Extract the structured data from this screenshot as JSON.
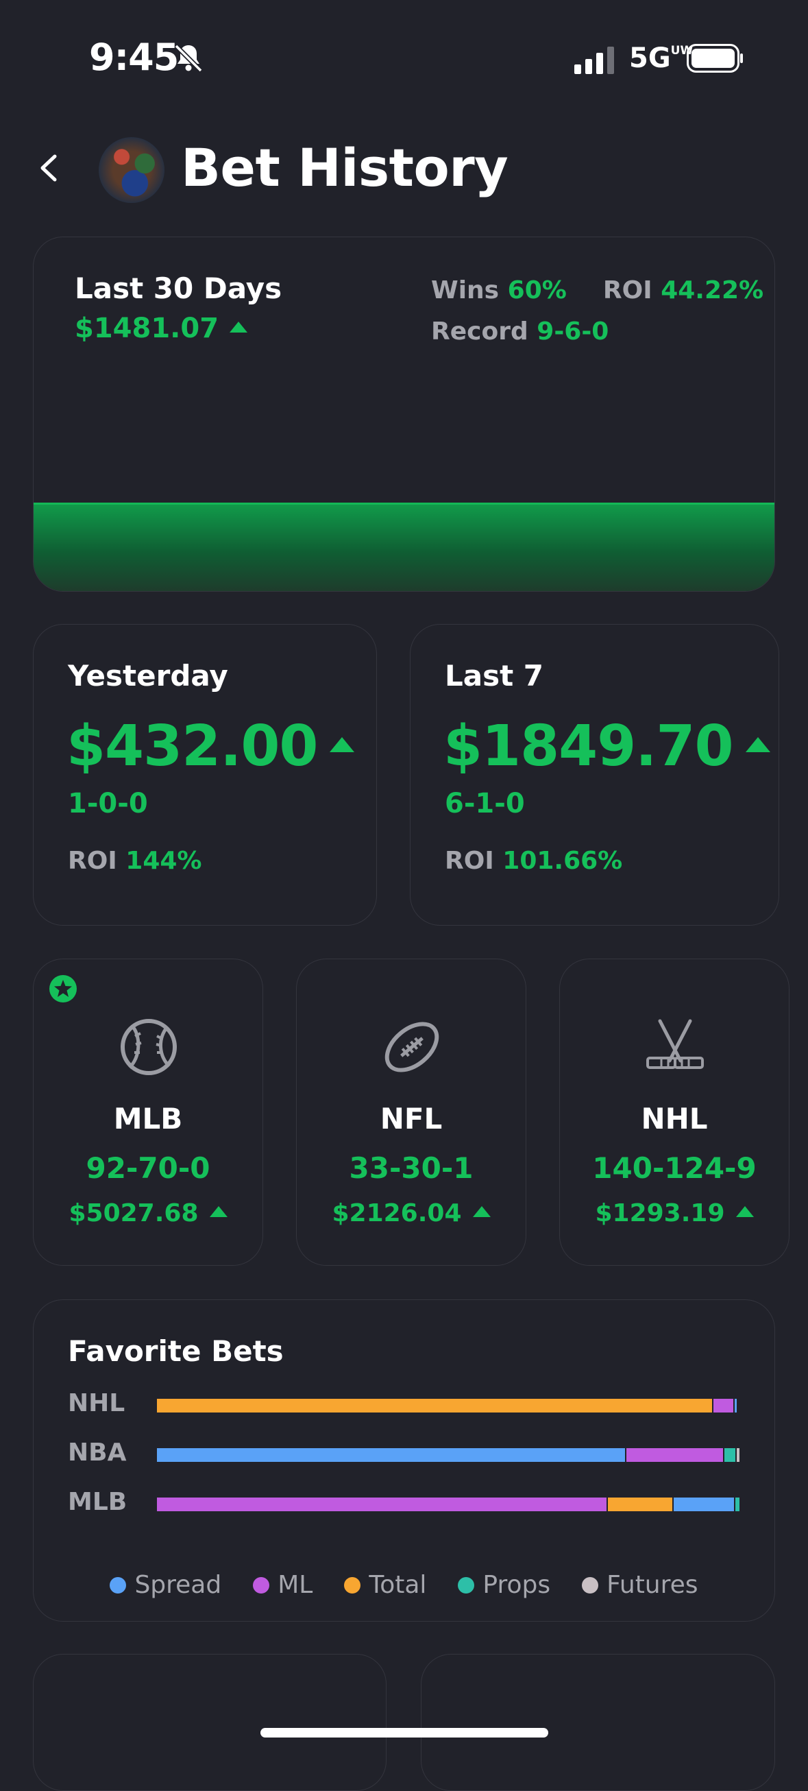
{
  "status_bar": {
    "time": "9:45",
    "network": "5G",
    "network_sup": "UW"
  },
  "header": {
    "title": "Bet History"
  },
  "last30": {
    "label": "Last 30 Days",
    "amount": "$1481.07",
    "wins_label": "Wins",
    "wins_value": "60%",
    "roi_label": "ROI",
    "roi_value": "44.22%",
    "record_label": "Record",
    "record_value": "9-6-0"
  },
  "periods": [
    {
      "label": "Yesterday",
      "amount": "$432.00",
      "record": "1-0-0",
      "roi_label": "ROI",
      "roi_value": "144%"
    },
    {
      "label": "Last 7",
      "amount": "$1849.70",
      "record": "6-1-0",
      "roi_label": "ROI",
      "roi_value": "101.66%"
    }
  ],
  "sports": [
    {
      "name": "MLB",
      "record": "92-70-0",
      "amount": "$5027.68",
      "icon": "baseball-icon",
      "favorite": true
    },
    {
      "name": "NFL",
      "record": "33-30-1",
      "amount": "$2126.04",
      "icon": "football-icon"
    },
    {
      "name": "NHL",
      "record": "140-124-9",
      "amount": "$1293.19",
      "icon": "hockey-sticks-icon"
    }
  ],
  "favorite_bets": {
    "title": "Favorite Bets",
    "rows": [
      {
        "label": "NHL",
        "segments": [
          {
            "type": "Total",
            "pct": 95.3
          },
          {
            "type": "ML",
            "pct": 3.6
          },
          {
            "type": "Spread",
            "pct": 0.6
          },
          {
            "type": "Props",
            "pct": 0.3
          }
        ]
      },
      {
        "label": "NBA",
        "segments": [
          {
            "type": "Spread",
            "pct": 80.4
          },
          {
            "type": "ML",
            "pct": 16.8
          },
          {
            "type": "Props",
            "pct": 2.1
          },
          {
            "type": "Futures",
            "pct": 0.7
          }
        ]
      },
      {
        "label": "MLB",
        "segments": [
          {
            "type": "ML",
            "pct": 77.2
          },
          {
            "type": "Total",
            "pct": 11.3
          },
          {
            "type": "Spread",
            "pct": 10.6
          },
          {
            "type": "Props",
            "pct": 0.9
          }
        ]
      }
    ],
    "legend": [
      {
        "name": "Spread",
        "color": "#5aa2f7"
      },
      {
        "name": "ML",
        "color": "#c05be0"
      },
      {
        "name": "Total",
        "color": "#f8a631"
      },
      {
        "name": "Props",
        "color": "#2dbfa8"
      },
      {
        "name": "Futures",
        "color": "#c9c0c4"
      }
    ]
  }
}
